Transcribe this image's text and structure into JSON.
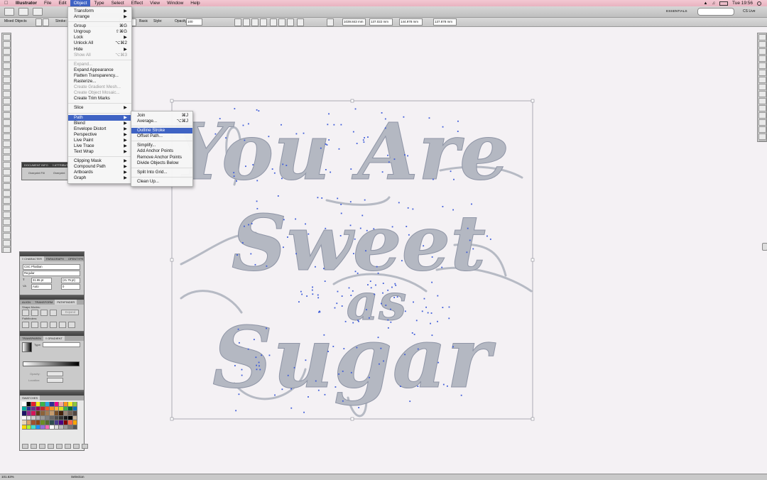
{
  "menubar": {
    "app": "Illustrator",
    "items": [
      "File",
      "Edit",
      "Object",
      "Type",
      "Select",
      "Effect",
      "View",
      "Window",
      "Help"
    ],
    "active": "Object",
    "clock": "Tue 19:56",
    "battery_icon": "battery-icon"
  },
  "appbar": {
    "workspace": "ESSENTIALS",
    "cs_live": "CS Live",
    "search_placeholder": ""
  },
  "controlbar": {
    "selection_label": "Mixed Objects",
    "stroke_label": "Stroke:",
    "basic": "Basic",
    "style": "Style:",
    "opacity_label": "Opacity:",
    "opacity": "100",
    "x": "1039.843 mm",
    "y": "137.022 mm",
    "w": "144.978 mm",
    "h": "137.878 mm"
  },
  "object_menu": {
    "items": [
      {
        "label": "Transform",
        "sc": "▶"
      },
      {
        "label": "Arrange",
        "sc": "▶"
      },
      {
        "sep": true
      },
      {
        "label": "Group",
        "sc": "⌘G"
      },
      {
        "label": "Ungroup",
        "sc": "⇧⌘G"
      },
      {
        "label": "Lock",
        "sc": "▶"
      },
      {
        "label": "Unlock All",
        "sc": "⌥⌘2"
      },
      {
        "label": "Hide",
        "sc": "▶"
      },
      {
        "label": "Show All",
        "sc": "⌥⌘3",
        "dis": true
      },
      {
        "sep": true
      },
      {
        "label": "Expand...",
        "dis": true
      },
      {
        "label": "Expand Appearance"
      },
      {
        "label": "Flatten Transparency..."
      },
      {
        "label": "Rasterize..."
      },
      {
        "label": "Create Gradient Mesh...",
        "dis": true
      },
      {
        "label": "Create Object Mosaic...",
        "dis": true
      },
      {
        "label": "Create Trim Marks"
      },
      {
        "sep": true
      },
      {
        "label": "Slice",
        "sc": "▶"
      },
      {
        "sep": true
      },
      {
        "label": "Path",
        "sc": "▶",
        "hl": true
      },
      {
        "label": "Blend",
        "sc": "▶"
      },
      {
        "label": "Envelope Distort",
        "sc": "▶"
      },
      {
        "label": "Perspective",
        "sc": "▶"
      },
      {
        "label": "Live Paint",
        "sc": "▶"
      },
      {
        "label": "Live Trace",
        "sc": "▶"
      },
      {
        "label": "Text Wrap",
        "sc": "▶"
      },
      {
        "sep": true
      },
      {
        "label": "Clipping Mask",
        "sc": "▶"
      },
      {
        "label": "Compound Path",
        "sc": "▶"
      },
      {
        "label": "Artboards",
        "sc": "▶"
      },
      {
        "label": "Graph",
        "sc": "▶"
      }
    ]
  },
  "path_menu": {
    "items": [
      {
        "label": "Join",
        "sc": "⌘J"
      },
      {
        "label": "Average...",
        "sc": "⌥⌘J"
      },
      {
        "sep": true
      },
      {
        "label": "Outline Stroke",
        "hl": true
      },
      {
        "label": "Offset Path..."
      },
      {
        "sep": true
      },
      {
        "label": "Simplify..."
      },
      {
        "label": "Add Anchor Points"
      },
      {
        "label": "Remove Anchor Points"
      },
      {
        "label": "Divide Objects Below"
      },
      {
        "sep": true
      },
      {
        "label": "Split Into Grid..."
      },
      {
        "sep": true
      },
      {
        "label": "Clean Up..."
      }
    ]
  },
  "artwork": {
    "line1": "You Are",
    "line2": "Sweet",
    "line3": "as",
    "line4": "Sugar"
  },
  "panels": {
    "info_tabs": [
      "DOCUMENT INFO",
      "◊ ATTRIBUTE"
    ],
    "info_row": [
      "Overprint Fill",
      "Overprint"
    ],
    "character_tabs": [
      "◊ CHARACTER",
      "PARAGRAPH",
      "OPENTYPE"
    ],
    "font": "CSC Phatban",
    "font_style": "Regular",
    "font_size": "31.95 pt",
    "leading": "(21.75 pt)",
    "kerning": "Auto",
    "tracking": "0",
    "pathfinder_tabs": [
      "ALIGN",
      "TRANSFORM",
      "PATHFINDER"
    ],
    "shape_modes": "Shape Modes:",
    "pathfinders": "Pathfinders:",
    "expand": "Expand",
    "gradient_tabs": [
      "TRANSPAREN",
      "◊ GRADIENT"
    ],
    "type_label": "Type:",
    "opacity_label": "Opacity:",
    "location_label": "Location:",
    "swatches_tab": "SWATCHES"
  },
  "status": {
    "zoom": "101.63%",
    "mode": "Selection"
  },
  "colors": {
    "menubar": "#f0c0cc",
    "highlight": "#3f63c4",
    "letter_fill": "#b4b8c2",
    "anchor": "#3d5bd8",
    "canvas": "#f4f1f4"
  }
}
